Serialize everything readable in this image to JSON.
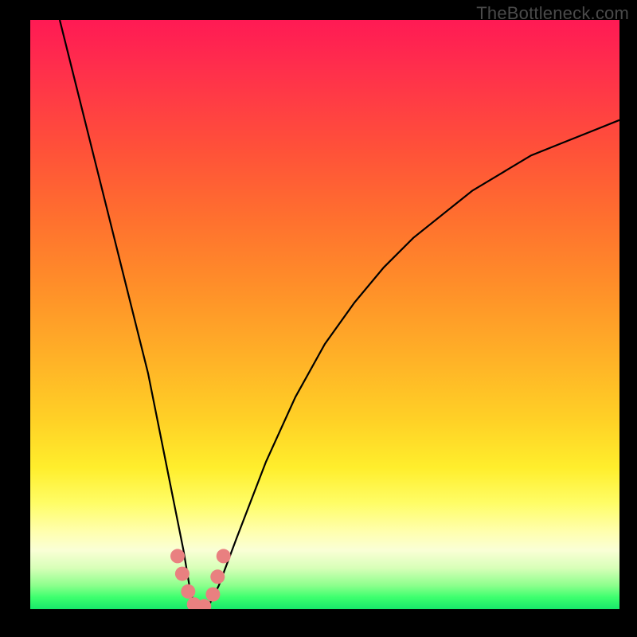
{
  "watermark": "TheBottleneck.com",
  "chart_data": {
    "type": "line",
    "title": "",
    "xlabel": "",
    "ylabel": "",
    "xlim": [
      0,
      100
    ],
    "ylim": [
      0,
      100
    ],
    "grid": false,
    "series": [
      {
        "name": "bottleneck-curve",
        "x": [
          5,
          8,
          11,
          14,
          17,
          20,
          22,
          24,
          26,
          27,
          28,
          30,
          32,
          35,
          40,
          45,
          50,
          55,
          60,
          65,
          70,
          75,
          80,
          85,
          90,
          95,
          100
        ],
        "y": [
          100,
          88,
          76,
          64,
          52,
          40,
          30,
          20,
          10,
          4,
          0,
          0,
          4,
          12,
          25,
          36,
          45,
          52,
          58,
          63,
          67,
          71,
          74,
          77,
          79,
          81,
          83
        ]
      }
    ],
    "markers": [
      {
        "x": 25.0,
        "y": 9.0
      },
      {
        "x": 25.8,
        "y": 6.0
      },
      {
        "x": 26.8,
        "y": 3.0
      },
      {
        "x": 27.8,
        "y": 0.8
      },
      {
        "x": 29.5,
        "y": 0.5
      },
      {
        "x": 31.0,
        "y": 2.5
      },
      {
        "x": 31.8,
        "y": 5.5
      },
      {
        "x": 32.8,
        "y": 9.0
      }
    ],
    "gradient_stops": [
      {
        "pos": 0,
        "color": "#ff1a54"
      },
      {
        "pos": 22,
        "color": "#ff5139"
      },
      {
        "pos": 45,
        "color": "#ff8e29"
      },
      {
        "pos": 68,
        "color": "#ffd126"
      },
      {
        "pos": 82,
        "color": "#fffd66"
      },
      {
        "pos": 93,
        "color": "#d8ffb8"
      },
      {
        "pos": 100,
        "color": "#17e86a"
      }
    ]
  }
}
